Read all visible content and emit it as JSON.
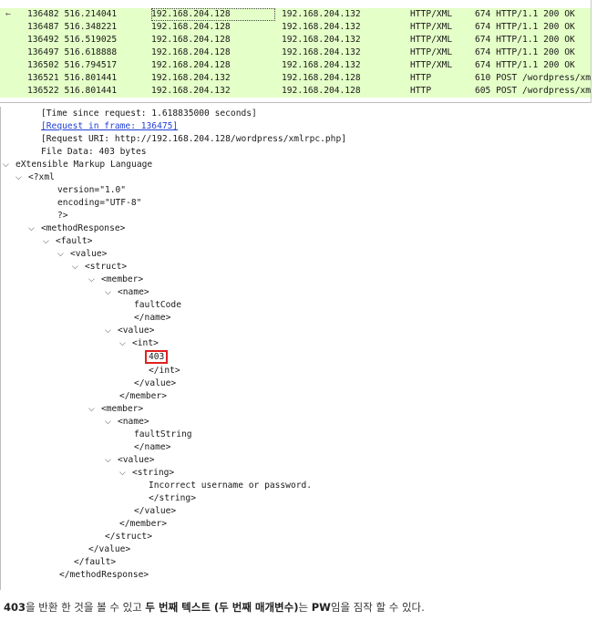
{
  "packets": [
    {
      "no": "136482",
      "time": "516.214041",
      "src": "192.168.204.128",
      "dst": "192.168.204.132",
      "proto": "HTTP/XML",
      "info": "674 HTTP/1.1 200 OK",
      "marker": "←",
      "selected": true
    },
    {
      "no": "136487",
      "time": "516.348221",
      "src": "192.168.204.128",
      "dst": "192.168.204.132",
      "proto": "HTTP/XML",
      "info": "674 HTTP/1.1 200 OK",
      "marker": "",
      "selected": false
    },
    {
      "no": "136492",
      "time": "516.519025",
      "src": "192.168.204.128",
      "dst": "192.168.204.132",
      "proto": "HTTP/XML",
      "info": "674 HTTP/1.1 200 OK",
      "marker": "",
      "selected": false
    },
    {
      "no": "136497",
      "time": "516.618888",
      "src": "192.168.204.128",
      "dst": "192.168.204.132",
      "proto": "HTTP/XML",
      "info": "674 HTTP/1.1 200 OK",
      "marker": "",
      "selected": false
    },
    {
      "no": "136502",
      "time": "516.794517",
      "src": "192.168.204.128",
      "dst": "192.168.204.132",
      "proto": "HTTP/XML",
      "info": "674 HTTP/1.1 200 OK",
      "marker": "",
      "selected": false
    },
    {
      "no": "136521",
      "time": "516.801441",
      "src": "192.168.204.132",
      "dst": "192.168.204.128",
      "proto": "HTTP",
      "info": "610 POST /wordpress/xm",
      "marker": "",
      "selected": false
    },
    {
      "no": "136522",
      "time": "516.801441",
      "src": "192.168.204.132",
      "dst": "192.168.204.128",
      "proto": "HTTP",
      "info": "605 POST /wordpress/xm",
      "marker": "",
      "selected": false
    }
  ],
  "detail": {
    "time_since_request": "[Time since request: 1.618835000 seconds]",
    "request_in_frame": "[Request in frame: 136475]",
    "request_uri": "[Request URI: http://192.168.204.128/wordpress/xmlrpc.php]",
    "file_data": "File Data: 403 bytes",
    "xml_root": "eXtensible Markup Language",
    "xml_decl": "<?xml",
    "version": "version=\"1.0\"",
    "encoding": "encoding=\"UTF-8\"",
    "xml_decl_end": "?>",
    "method_response": "<methodResponse>",
    "fault": "<fault>",
    "value": "<value>",
    "struct": "<struct>",
    "member": "<member>",
    "name": "<name>",
    "fault_code": "faultCode",
    "name_close": "</name>",
    "int": "<int>",
    "int_value": "403",
    "int_close": "</int>",
    "value_close": "</value>",
    "member_close": "</member>",
    "fault_string": "faultString",
    "string": "<string>",
    "string_value": "Incorrect username or password.",
    "string_close": "</string>",
    "struct_close": "</struct>",
    "fault_close": "</fault>",
    "method_response_close": "</methodResponse>"
  },
  "caption": {
    "p1": "403",
    "p2": "을 반환 한 것을 볼 수 있고 ",
    "p3": "두 번째 텍스트 (두 번째 매개변수)",
    "p4": "는 ",
    "p5": "PW",
    "p6": "임을 짐작 할 수 있다."
  },
  "colors": {
    "row_bg": "#e4ffc7",
    "link": "#1f3fd6",
    "highlight_box": "#e02020"
  }
}
